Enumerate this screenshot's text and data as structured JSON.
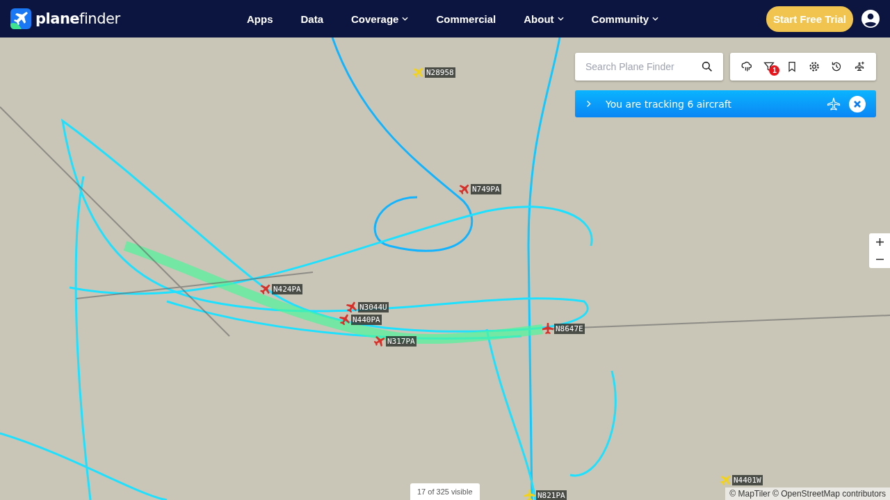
{
  "brand": {
    "name_bold": "plane",
    "name_light": "finder"
  },
  "nav": [
    {
      "label": "Apps",
      "dropdown": false
    },
    {
      "label": "Data",
      "dropdown": false
    },
    {
      "label": "Coverage",
      "dropdown": true
    },
    {
      "label": "Commercial",
      "dropdown": false
    },
    {
      "label": "About",
      "dropdown": true
    },
    {
      "label": "Community",
      "dropdown": true
    }
  ],
  "trial_button": "Start Free Trial",
  "search": {
    "placeholder": "Search Plane Finder"
  },
  "toolbar": {
    "filter_badge": "1"
  },
  "tracking_banner": "You are tracking 6 aircraft",
  "aircraft": [
    {
      "callsign": "N28958",
      "color": "#f2d21b"
    },
    {
      "callsign": "N749PA",
      "color": "#d6322b"
    },
    {
      "callsign": "N424PA",
      "color": "#d6322b"
    },
    {
      "callsign": "N3044U",
      "color": "#d6322b"
    },
    {
      "callsign": "N440PA",
      "color": "#d6322b"
    },
    {
      "callsign": "N317PA",
      "color": "#d6322b"
    },
    {
      "callsign": "N8647E",
      "color": "#d6322b"
    },
    {
      "callsign": "N821PA",
      "color": "#f2d21b"
    },
    {
      "callsign": "N4401W",
      "color": "#f2d21b"
    }
  ],
  "visible_count": "17 of 325 visible",
  "attribution": "© MapTiler © OpenStreetMap contributors"
}
